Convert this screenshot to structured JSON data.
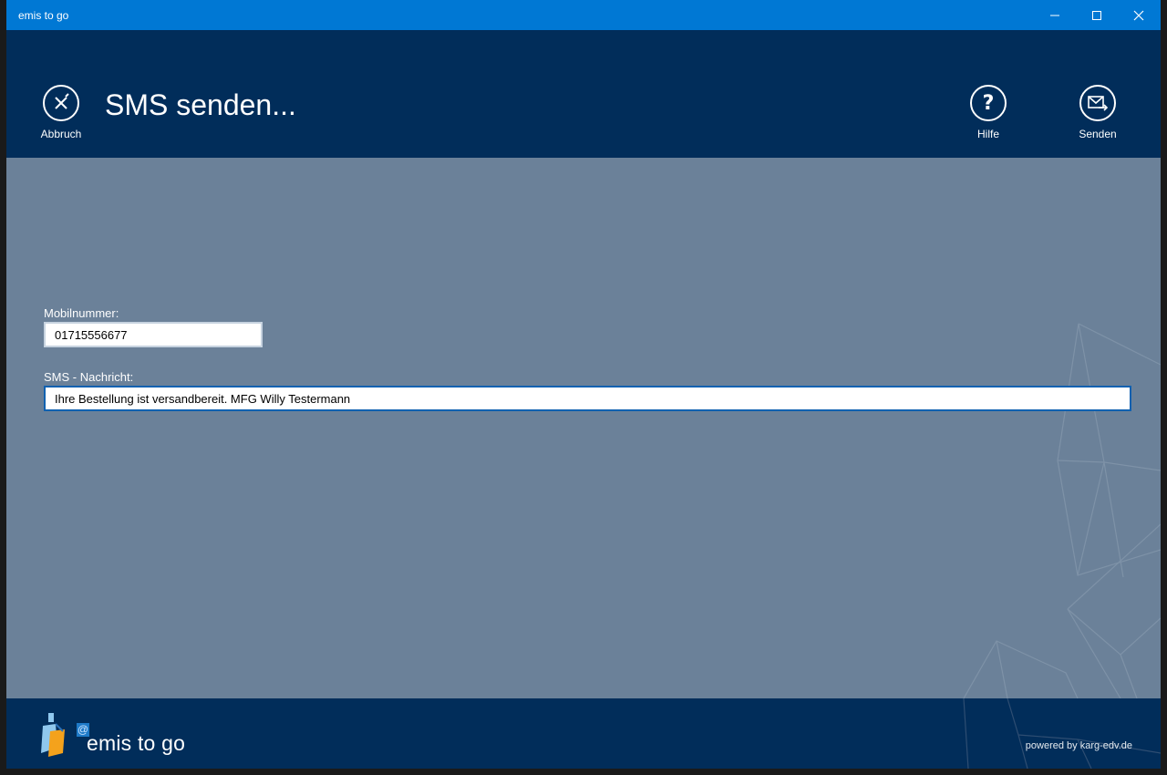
{
  "window": {
    "title": "emis to go"
  },
  "header": {
    "title": "SMS senden...",
    "cancel_label": "Abbruch",
    "help_label": "Hilfe",
    "send_label": "Senden"
  },
  "form": {
    "mobile_label": "Mobilnummer:",
    "mobile_value": "01715556677",
    "message_label": "SMS - Nachricht:",
    "message_value": "Ihre Bestellung ist versandbereit. MFG Willy Testermann"
  },
  "footer": {
    "logo_text": "emis to go",
    "at_symbol": "@",
    "powered": "powered by karg-edv.de"
  },
  "colors": {
    "titlebar": "#0078d4",
    "header": "#012d5a",
    "content": "#6b8199",
    "accent_input_border": "#1061b0"
  },
  "icons": {
    "cancel": "close-circle-icon",
    "help": "question-circle-icon",
    "send": "mail-send-icon"
  }
}
